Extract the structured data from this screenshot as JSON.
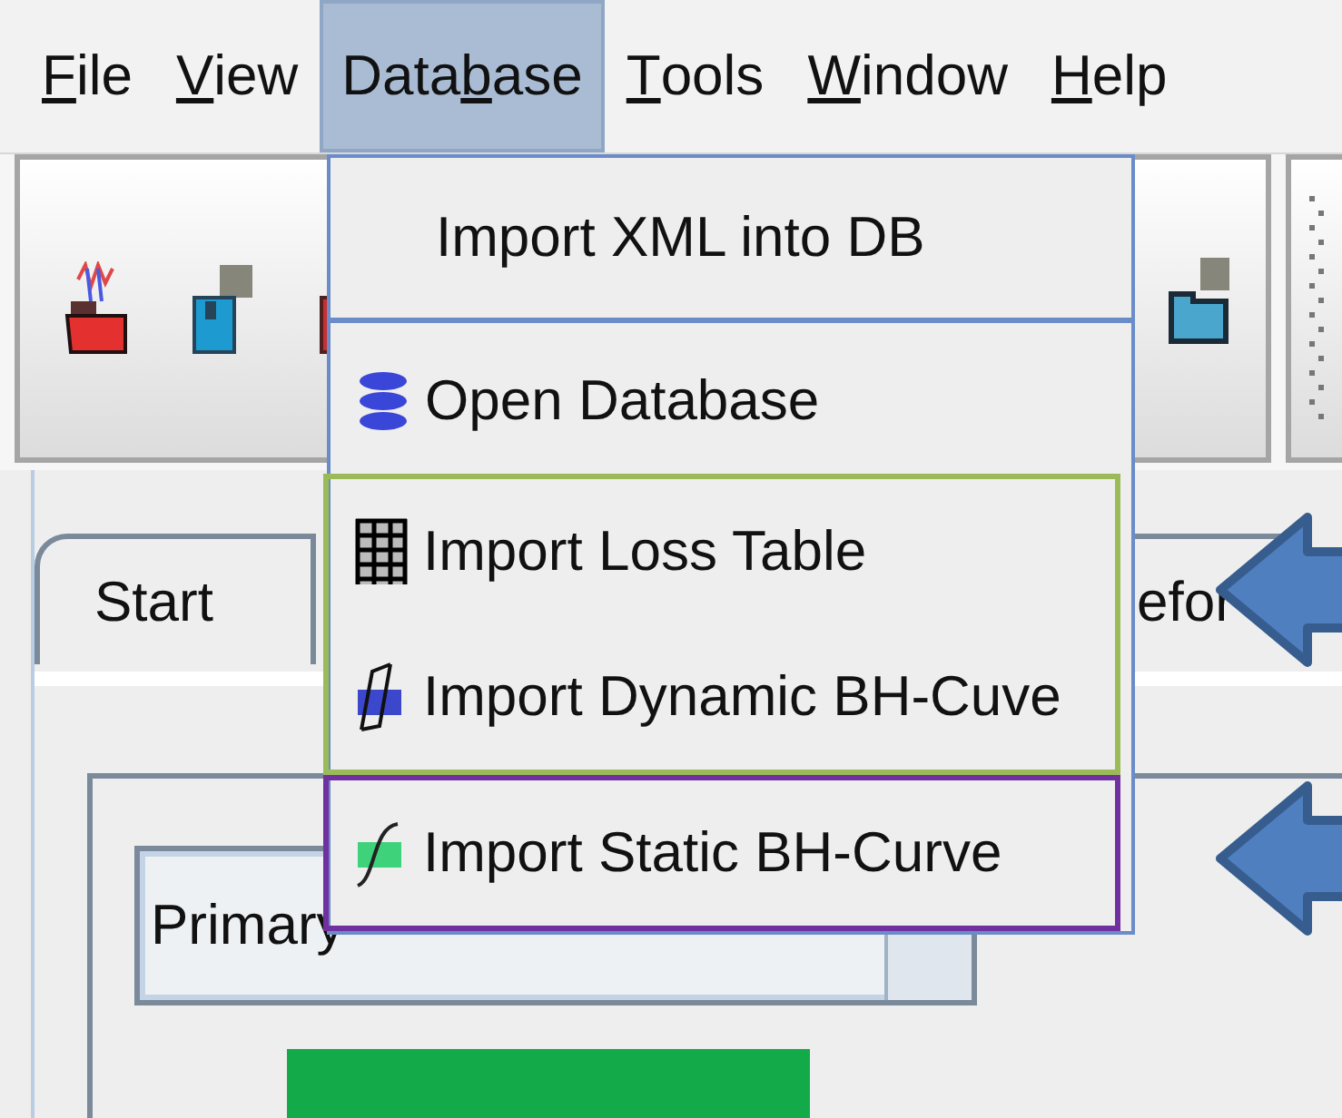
{
  "menubar": [
    {
      "key": "F",
      "after": "ile",
      "selected": false
    },
    {
      "key": "V",
      "after": "iew",
      "selected": false
    },
    {
      "before": "Data",
      "key": "b",
      "after": "ase",
      "selected": true
    },
    {
      "key": "T",
      "after": "ools",
      "selected": false
    },
    {
      "key": "W",
      "after": "indow",
      "selected": false
    },
    {
      "key": "H",
      "after": "elp",
      "selected": false
    }
  ],
  "menu": {
    "groups": [
      {
        "items": [
          {
            "label": "Import XML into DB",
            "kind": "plain"
          }
        ]
      },
      {
        "items": [
          {
            "label": "Open Database",
            "kind": "database"
          }
        ]
      },
      {
        "color": "#9bbb59",
        "items": [
          {
            "label": "Import Loss Table",
            "kind": "table"
          },
          {
            "label": "Import Dynamic BH-Cuve",
            "kind": "dynamic"
          }
        ]
      },
      {
        "color": "#7030a0",
        "items": [
          {
            "label": "Import Static BH-Curve",
            "kind": "static"
          }
        ]
      }
    ]
  },
  "tabs": [
    {
      "label": "Start"
    },
    {
      "label": "efor"
    }
  ],
  "combo": {
    "value": "Primary"
  }
}
